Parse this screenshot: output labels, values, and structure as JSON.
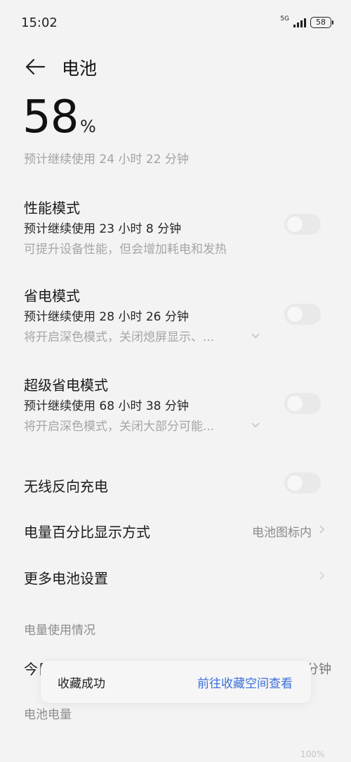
{
  "status_bar": {
    "time": "15:02",
    "network": "5G",
    "battery_level": "58"
  },
  "header": {
    "title": "电池"
  },
  "battery": {
    "percent": "58",
    "unit": "%",
    "estimate": "预计继续使用 24 小时 22 分钟"
  },
  "modes": [
    {
      "title": "性能模式",
      "estimate": "预计继续使用 23 小时 8 分钟",
      "description": "可提升设备性能，但会增加耗电和发热",
      "enabled": false
    },
    {
      "title": "省电模式",
      "estimate": "预计继续使用 28 小时 26 分钟",
      "description": "将开启深色模式，关闭熄屏显示、...",
      "enabled": false
    },
    {
      "title": "超级省电模式",
      "estimate": "预计继续使用 68 小时 38 分钟",
      "description": "将开启深色模式，关闭大部分可能...",
      "enabled": false
    }
  ],
  "settings": {
    "wireless_reverse_label": "无线反向充电",
    "wireless_reverse_enabled": false,
    "percent_display_label": "电量百分比显示方式",
    "percent_display_value": "电池图标内",
    "more_settings_label": "更多电池设置"
  },
  "usage": {
    "section_title": "电量使用情况",
    "today_label": "今日",
    "today_right": "分钟",
    "battery_section": "电池电量",
    "axis_top": "100%"
  },
  "toast": {
    "message": "收藏成功",
    "action": "前往收藏空间查看"
  },
  "colors": {
    "link": "#3a6fd8",
    "background": "#f3f3f3"
  }
}
